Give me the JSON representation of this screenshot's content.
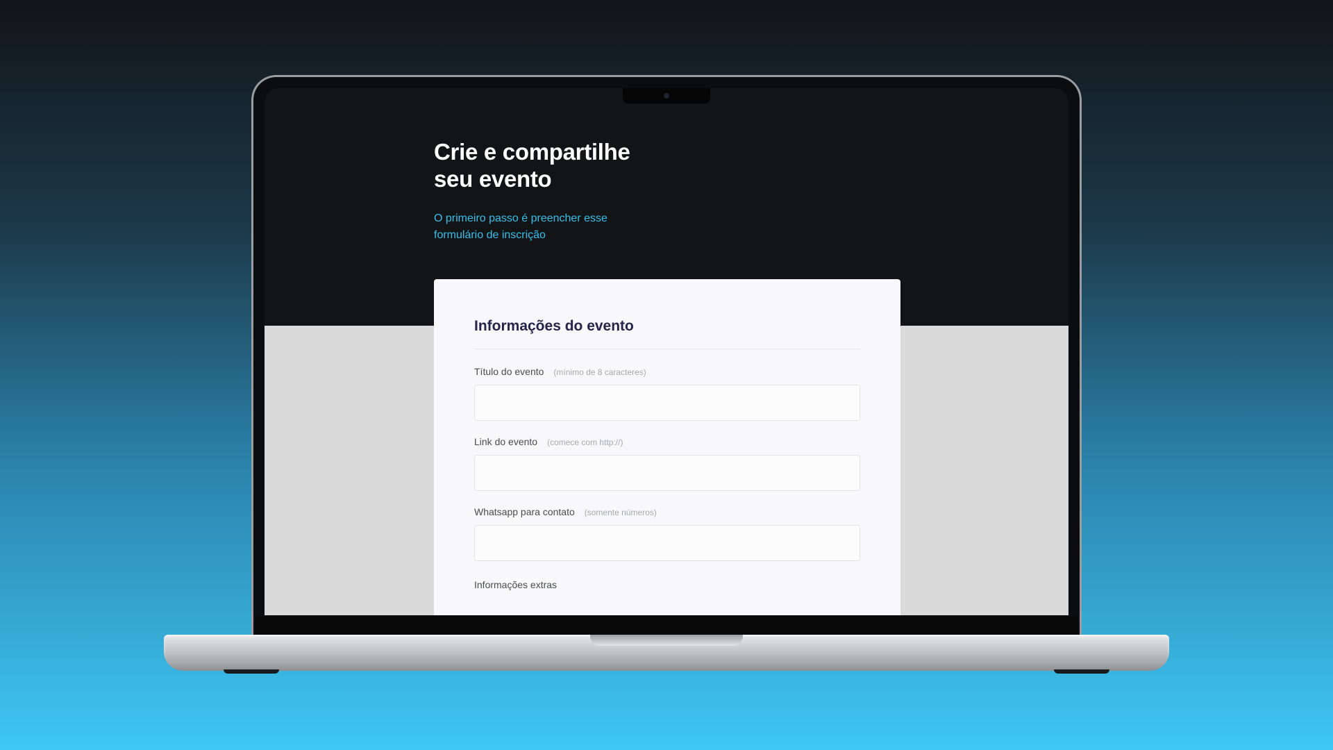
{
  "hero": {
    "title_line1": "Crie e compartilhe",
    "title_line2": "seu evento",
    "subtitle": "O primeiro passo é preencher esse formulário de inscrição"
  },
  "form": {
    "section_title": "Informações do evento",
    "fields": [
      {
        "label": "Título do evento",
        "hint": "(mínimo de 8 caracteres)",
        "value": ""
      },
      {
        "label": "Link do evento",
        "hint": "(comece com http://)",
        "value": ""
      },
      {
        "label": "Whatsapp para contato",
        "hint": "(somente números)",
        "value": ""
      }
    ],
    "extras_label": "Informações extras"
  },
  "colors": {
    "accent": "#34c0ec",
    "screen_dark": "#131416",
    "screen_light": "#dadadb",
    "card_title": "#28234a"
  }
}
